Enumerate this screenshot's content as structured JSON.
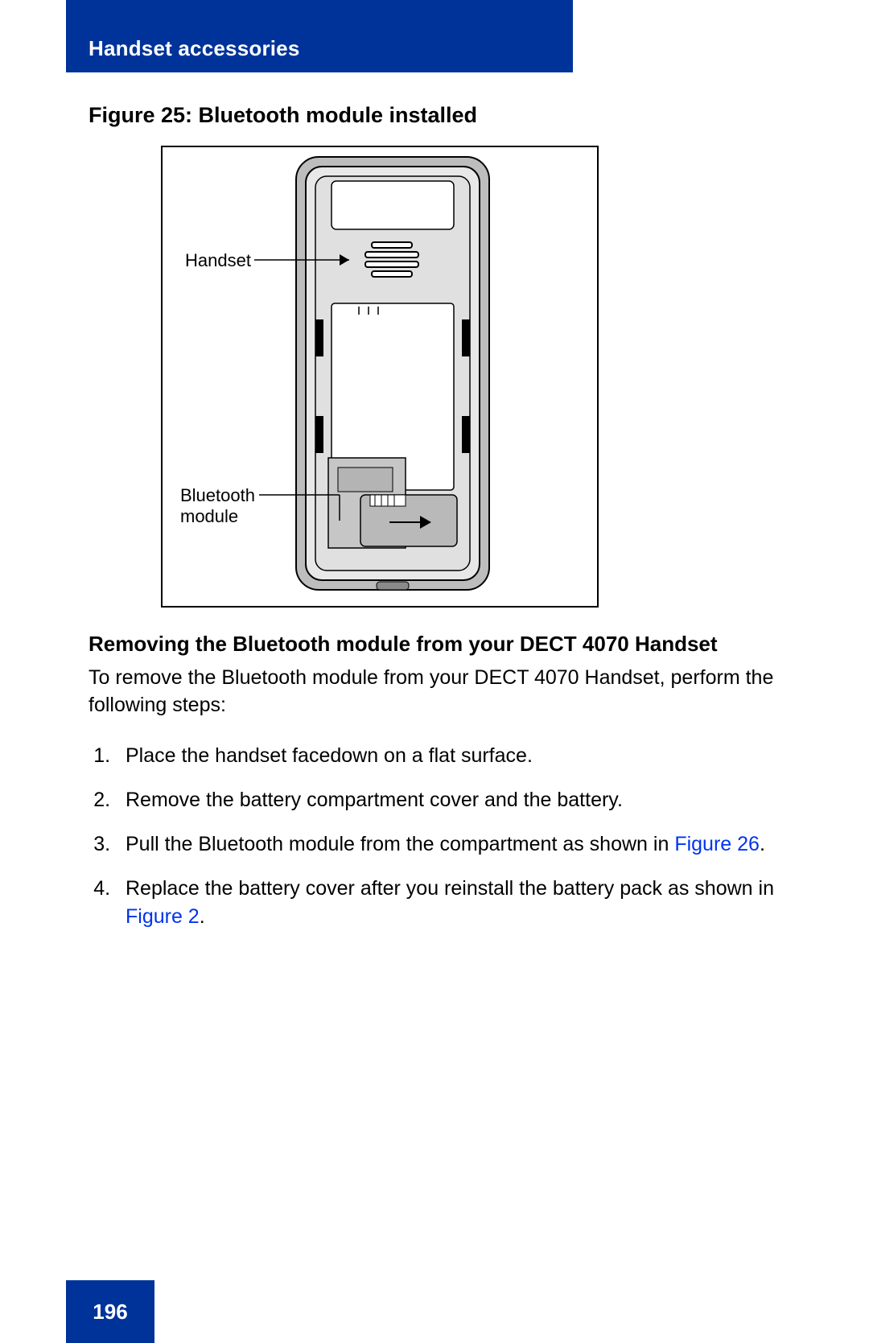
{
  "header": {
    "section_title": "Handset accessories"
  },
  "figure": {
    "title": "Figure 25: Bluetooth module installed",
    "callouts": {
      "handset": "Handset",
      "bluetooth_line1": "Bluetooth",
      "bluetooth_line2": "module"
    }
  },
  "section": {
    "subheading": "Removing the Bluetooth module from your DECT 4070 Handset",
    "intro": "To remove the Bluetooth module from your DECT 4070 Handset, perform the following steps:",
    "steps": [
      {
        "text": "Place the handset facedown on a flat surface."
      },
      {
        "text": "Remove the battery compartment cover and the battery."
      },
      {
        "text_before_link": "Pull the Bluetooth module from the compartment as shown in ",
        "link": "Figure 26",
        "text_after_link": "."
      },
      {
        "text_before_link": "Replace the battery cover after you reinstall the battery pack as shown in ",
        "link": "Figure 2",
        "text_after_link": "."
      }
    ]
  },
  "footer": {
    "page_number": "196"
  }
}
